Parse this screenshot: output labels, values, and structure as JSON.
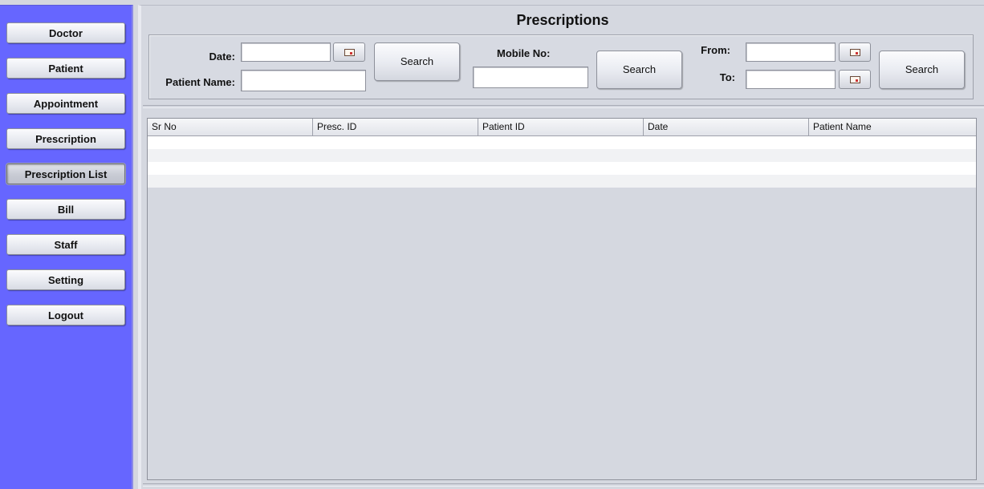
{
  "sidebar": {
    "items": [
      {
        "label": "Doctor"
      },
      {
        "label": "Patient"
      },
      {
        "label": "Appointment"
      },
      {
        "label": "Prescription"
      },
      {
        "label": "Prescription List",
        "active": true
      },
      {
        "label": "Bill"
      },
      {
        "label": "Staff"
      },
      {
        "label": "Setting"
      },
      {
        "label": "Logout"
      }
    ]
  },
  "main": {
    "title": "Prescriptions",
    "search": {
      "date_label": "Date:",
      "date_value": "",
      "patient_name_label": "Patient Name:",
      "patient_name_value": "",
      "search_by_date_label": "Search",
      "mobile_label": "Mobile No:",
      "mobile_value": "",
      "search_by_mobile_label": "Search",
      "from_label": "From:",
      "from_value": "",
      "to_label": "To:",
      "to_value": "",
      "search_by_range_label": "Search"
    },
    "table": {
      "columns": [
        "Sr No",
        "Presc. ID",
        "Patient ID",
        "Date",
        "Patient Name"
      ],
      "rows": []
    }
  },
  "colors": {
    "sidebar_bg": "#6666ff",
    "panel_bg": "#d5d8e0"
  },
  "icons": {
    "calendar": "calendar-icon"
  }
}
